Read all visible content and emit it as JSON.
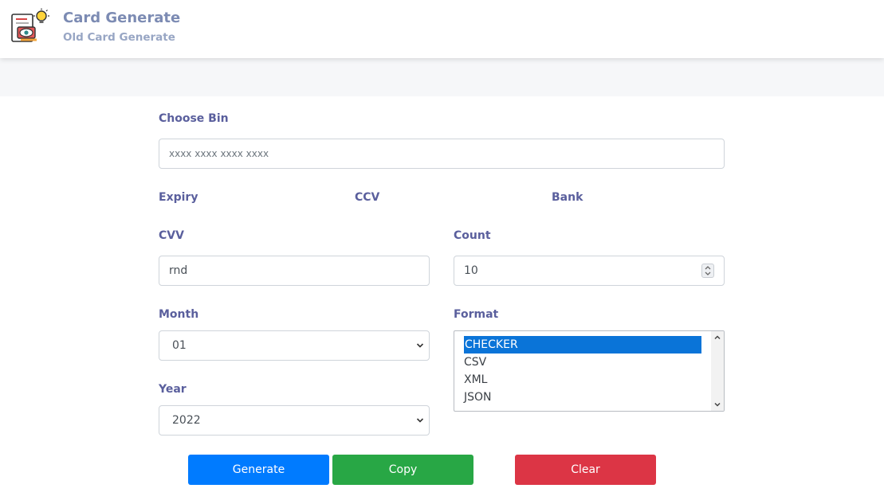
{
  "header": {
    "title": "Card Generate",
    "subtitle": "Old Card Generate",
    "logo_icon": "card-idea-icon"
  },
  "bin": {
    "label": "Choose Bin",
    "placeholder": "xxxx xxxx xxxx xxxx",
    "value": ""
  },
  "info": {
    "expiry_label": "Expiry",
    "ccv_label": "CCV",
    "bank_label": "Bank"
  },
  "cvv": {
    "label": "CVV",
    "value": "rnd"
  },
  "count": {
    "label": "Count",
    "value": "10"
  },
  "month": {
    "label": "Month",
    "selected": "01"
  },
  "year": {
    "label": "Year",
    "selected": "2022"
  },
  "format": {
    "label": "Format",
    "options": [
      "CHECKER",
      "CSV",
      "XML",
      "JSON"
    ],
    "selected_index": 0
  },
  "buttons": {
    "generate": "Generate",
    "copy": "Copy",
    "clear": "Clear"
  },
  "colors": {
    "generate": "#007bff",
    "copy": "#28a745",
    "clear": "#dc3545",
    "label": "#5a5f9d",
    "selection": "#0a74d8"
  }
}
